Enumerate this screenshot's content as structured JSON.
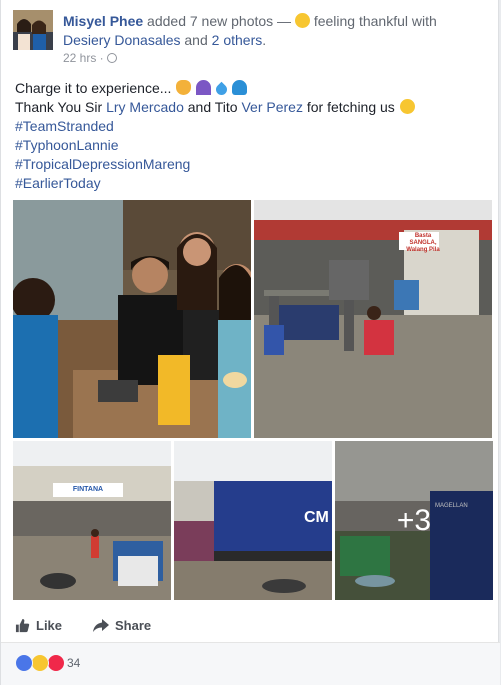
{
  "post": {
    "author": "Misyel Phee",
    "action_text": "added 7 new photos —",
    "feeling": "feeling thankful with",
    "tagged_1": "Desiery Donasales",
    "and_text": "and",
    "tagged_others": "2 others",
    "period": ".",
    "time": "22 hrs ·",
    "line1": "Charge it to experience...",
    "line2_a": "Thank You Sir",
    "line2_name1": "Lry Mercado",
    "line2_b": "and Tito",
    "line2_name2": "Ver Perez",
    "line2_c": "for fetching us",
    "hashtags": [
      "#TeamStranded",
      "#TyphoonLannie",
      "#TropicalDepressionMareng",
      "#EarlierToday"
    ],
    "photo_sign_1": "Basta SANGLA, Walang Pila",
    "photo_sign_2": "FINTANA",
    "container_text": "CM",
    "container_brand": "MAGELLAN",
    "more_photos": "+3"
  },
  "actions": {
    "like": "Like",
    "share": "Share"
  },
  "reactions": {
    "count": "34"
  },
  "colors": {
    "link": "#365899",
    "like_blue": "#4a76e8",
    "love_red": "#f0284a",
    "wow_yellow": "#f7c631"
  }
}
